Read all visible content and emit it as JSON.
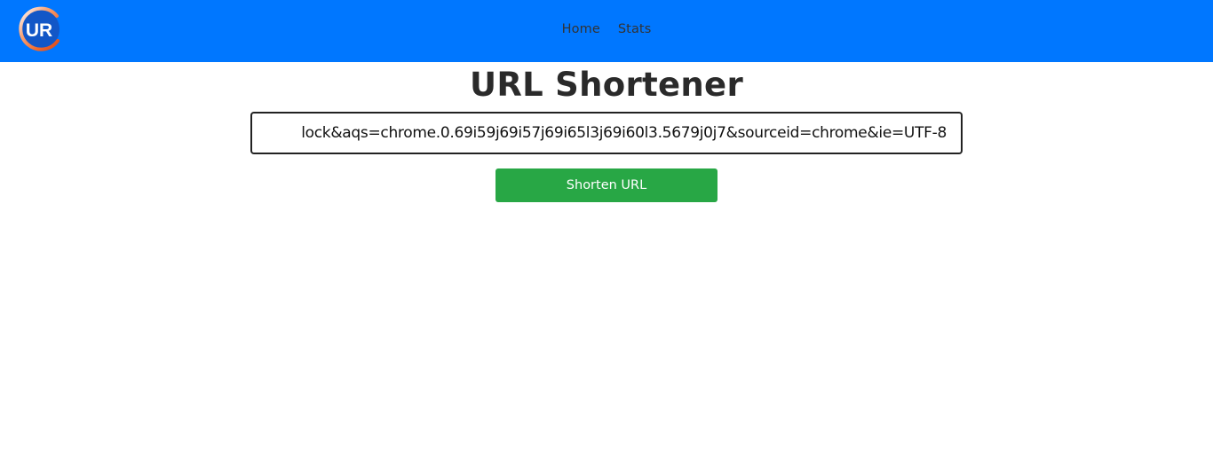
{
  "navbar": {
    "logo_text": "UR",
    "links": [
      {
        "label": "Home"
      },
      {
        "label": "Stats"
      }
    ],
    "colors": {
      "background": "#0077ff",
      "link": "#333333"
    }
  },
  "main": {
    "title": "URL Shortener",
    "url_input": {
      "value": "lock&aqs=chrome.0.69i59j69i57j69i65l3j69i60l3.5679j0j7&sourceid=chrome&ie=UTF-8"
    },
    "shorten_button": {
      "label": "Shorten URL",
      "color": "#28a745"
    }
  }
}
